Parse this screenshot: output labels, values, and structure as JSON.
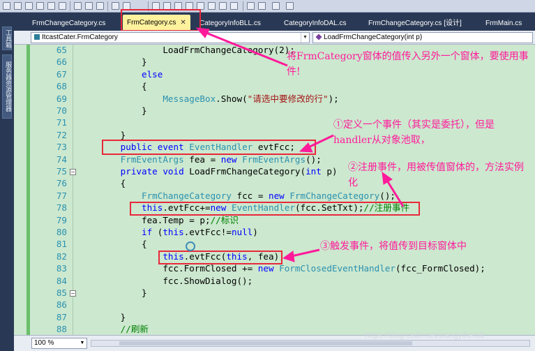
{
  "toolbar": {
    "icons": [
      "cut-icon",
      "copy-icon",
      "paste-icon",
      "format-icon",
      "indent-icon",
      "outdent-icon",
      "comment-icon",
      "uncomment-icon",
      "bookmark-icon",
      "nav-icon",
      "up-arrow-icon"
    ]
  },
  "side_tabs": [
    "工具箱",
    "服务器资源管理器"
  ],
  "tabs": [
    {
      "label": "FrmChangeCategory.cs",
      "active": false
    },
    {
      "label": "FrmCategory.cs",
      "active": true,
      "close": "✕"
    },
    {
      "label": "CategoryInfoBLL.cs",
      "active": false
    },
    {
      "label": "CategoryInfoDAL.cs",
      "active": false
    },
    {
      "label": "FrmChangeCategory.cs [设计]",
      "active": false
    },
    {
      "label": "FrmMain.cs",
      "active": false
    }
  ],
  "nav": {
    "class_combo": "ItcastCater.FrmCategory",
    "member_combo": "LoadFrmChangeCategory(int p)"
  },
  "code_lines": [
    {
      "n": "65",
      "html": "                LoadFrmChangeCategory(2);"
    },
    {
      "n": "66",
      "html": "            }"
    },
    {
      "n": "67",
      "html": "            <span class=\"kw\">else</span>"
    },
    {
      "n": "68",
      "html": "            {"
    },
    {
      "n": "69",
      "html": "                <span class=\"ty\">MessageBox</span>.Show(<span class=\"st\">\"请选中要修改的行\"</span>);"
    },
    {
      "n": "70",
      "html": "            }"
    },
    {
      "n": "71",
      "html": ""
    },
    {
      "n": "72",
      "html": "        }"
    },
    {
      "n": "73",
      "html": "        <span class=\"kw\">public</span> <span class=\"kw\">event</span> <span class=\"ty\">EventHandler</span> evtFcc;"
    },
    {
      "n": "74",
      "html": "        <span class=\"ty\">FrmEventArgs</span> fea = <span class=\"kw\">new</span> <span class=\"ty\">FrmEventArgs</span>();"
    },
    {
      "n": "75",
      "html": "        <span class=\"kw\">private</span> <span class=\"kw\">void</span> LoadFrmChangeCategory(<span class=\"kw\">int</span> p)"
    },
    {
      "n": "76",
      "html": "        {"
    },
    {
      "n": "77",
      "html": "            <span class=\"ty\">FrmChangeCategory</span> fcc = <span class=\"kw\">new</span> <span class=\"ty\">FrmChangeCategory</span>();"
    },
    {
      "n": "78",
      "html": "            <span class=\"kw\">this</span>.evtFcc+=<span class=\"kw\">new</span> <span class=\"ty\">EventHandler</span>(fcc.SetTxt);<span class=\"cm\">//注册事件</span>"
    },
    {
      "n": "79",
      "html": "            fea.Temp = p;<span class=\"cm\">//标识</span>"
    },
    {
      "n": "80",
      "html": "            <span class=\"kw\">if</span> (<span class=\"kw\">this</span>.evtFcc!=<span class=\"kw\">null</span>)"
    },
    {
      "n": "81",
      "html": "            {"
    },
    {
      "n": "82",
      "html": "                <span class=\"kw\">this</span>.evtFcc(<span class=\"kw\">this</span>, fea);"
    },
    {
      "n": "83",
      "html": "                fcc.FormClosed += <span class=\"kw\">new</span> <span class=\"ty\">FormClosedEventHandler</span>(fcc_FormClosed);"
    },
    {
      "n": "84",
      "html": "                fcc.ShowDialog();"
    },
    {
      "n": "85",
      "html": "            }"
    },
    {
      "n": "86",
      "html": ""
    },
    {
      "n": "87",
      "html": "        }"
    },
    {
      "n": "88",
      "html": "        <span class=\"cm\">//刷新</span>"
    }
  ],
  "annotations": {
    "note_top": "将FrmCategory窗体的值传入另外一个窗体，要使用事件!",
    "note1": "①定义一个事件（其实是委托），但是handler从对象池取，",
    "note2": "②注册事件，用被传值窗体的，方法实例化",
    "note3": "③触发事件，将值传到目标窗体中"
  },
  "status": {
    "zoom": "100 %"
  },
  "watermark": "https://blog.csdn.net/wangyihero8",
  "colors": {
    "annotation": "#ff1a9a",
    "highlight_box": "#e8283a",
    "editor_bg": "#cce8cf",
    "active_tab": "#fff29d"
  }
}
